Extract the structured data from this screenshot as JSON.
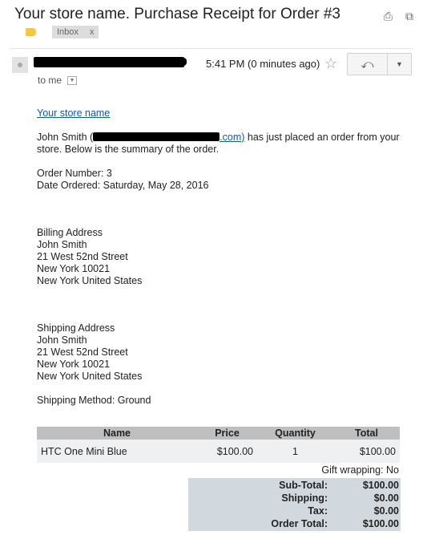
{
  "email": {
    "subject": "Your store name. Purchase Receipt for Order #3",
    "label_chip": "Inbox",
    "label_chip_close": "x",
    "time": "5:41 PM (0 minutes ago)",
    "recipient": "to me"
  },
  "icons": {
    "print": "print-icon",
    "popout": "open-in-new-window-icon",
    "label": "label-tag-icon",
    "star": "star-icon",
    "reply": "reply-icon",
    "more": "chevron-down-icon"
  },
  "glyphs": {
    "print": "⎙",
    "popout": "⧉",
    "star": "☆",
    "reply": "⤺",
    "more": "▼",
    "to_me_dd": "▼"
  },
  "body": {
    "store_link": "Your store name",
    "customer_name": "John Smith",
    "email_tail": ".com)",
    "intro_rest": " has just placed an order from your store. Below is the summary of the order.",
    "order_number": "Order Number: 3",
    "date_ordered": "Date Ordered: Saturday, May 28, 2016",
    "billing": {
      "heading": "Billing Address",
      "name": "John Smith",
      "street": "21 West 52nd Street",
      "city": "New York 10021",
      "country": "New York United States"
    },
    "shipping": {
      "heading": "Shipping Address",
      "name": "John Smith",
      "street": "21 West 52nd Street",
      "city": "New York 10021",
      "country": "New York United States"
    },
    "shipping_method": "Shipping Method: Ground"
  },
  "items_table": {
    "headers": [
      "Name",
      "Price",
      "Quantity",
      "Total"
    ],
    "rows": [
      [
        "HTC One Mini Blue",
        "$100.00",
        "1",
        "$100.00"
      ]
    ]
  },
  "gift_wrapping": "Gift wrapping: No",
  "totals": [
    {
      "label": "Sub-Total:",
      "value": "$100.00"
    },
    {
      "label": "Shipping:",
      "value": "$0.00"
    },
    {
      "label": "Tax:",
      "value": "$0.00"
    },
    {
      "label": "Order Total:",
      "value": "$100.00"
    }
  ]
}
